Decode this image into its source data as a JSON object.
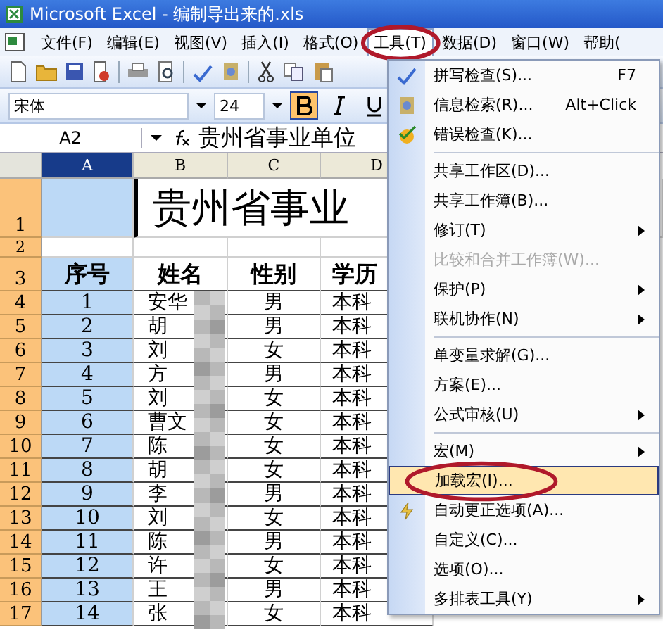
{
  "window": {
    "title": "Microsoft Excel - 编制导出来的.xls"
  },
  "menu_bar": [
    {
      "label": "文件(F)",
      "selected": false
    },
    {
      "label": "编辑(E)",
      "selected": false
    },
    {
      "label": "视图(V)",
      "selected": false
    },
    {
      "label": "插入(I)",
      "selected": false
    },
    {
      "label": "格式(O)",
      "selected": false
    },
    {
      "label": "工具(T)",
      "selected": true,
      "circled": true
    },
    {
      "label": "数据(D)",
      "selected": false
    },
    {
      "label": "窗口(W)",
      "selected": false
    },
    {
      "label": "帮助(",
      "selected": false
    }
  ],
  "format_toolbar": {
    "font": "宋体",
    "size": "24",
    "bold": true,
    "italic": false,
    "underline": false
  },
  "formula_bar": {
    "name_box": "A2",
    "content": "贵州省事业单位"
  },
  "sheet": {
    "columns": [
      {
        "label": "A",
        "selected": true
      },
      {
        "label": "B",
        "selected": false
      },
      {
        "label": "C",
        "selected": false
      },
      {
        "label": "D",
        "selected": false
      }
    ],
    "top_rows": [
      "1",
      "2",
      "3"
    ],
    "title": "贵州省事业",
    "headers": [
      "序号",
      "姓名",
      "性别",
      "学历"
    ],
    "rows": [
      {
        "row": "4",
        "cells": [
          "1",
          "安华",
          "男",
          "本科"
        ]
      },
      {
        "row": "5",
        "cells": [
          "2",
          "胡",
          "男",
          "本科"
        ]
      },
      {
        "row": "6",
        "cells": [
          "3",
          "刘",
          "女",
          "本科"
        ]
      },
      {
        "row": "7",
        "cells": [
          "4",
          "方",
          "男",
          "本科"
        ]
      },
      {
        "row": "8",
        "cells": [
          "5",
          "刘",
          "女",
          "本科"
        ]
      },
      {
        "row": "9",
        "cells": [
          "6",
          "曹文",
          "女",
          "本科"
        ]
      },
      {
        "row": "10",
        "cells": [
          "7",
          "陈",
          "女",
          "本科"
        ]
      },
      {
        "row": "11",
        "cells": [
          "8",
          "胡",
          "女",
          "本科"
        ]
      },
      {
        "row": "12",
        "cells": [
          "9",
          "李",
          "男",
          "本科"
        ]
      },
      {
        "row": "13",
        "cells": [
          "10",
          "刘",
          "女",
          "本科"
        ]
      },
      {
        "row": "14",
        "cells": [
          "11",
          "陈",
          "男",
          "本科"
        ]
      },
      {
        "row": "15",
        "cells": [
          "12",
          "许",
          "女",
          "本科"
        ]
      },
      {
        "row": "16",
        "cells": [
          "13",
          "王",
          "男",
          "本科"
        ]
      },
      {
        "row": "17",
        "cells": [
          "14",
          "张",
          "女",
          "本科"
        ]
      }
    ]
  },
  "tools_menu": {
    "items": [
      {
        "kind": "item",
        "label": "拼写检查(S)...",
        "shortcut": "F7"
      },
      {
        "kind": "item",
        "label": "信息检索(R)...",
        "shortcut": "Alt+Click"
      },
      {
        "kind": "item",
        "label": "错误检查(K)..."
      },
      {
        "kind": "separator"
      },
      {
        "kind": "item",
        "label": "共享工作区(D)..."
      },
      {
        "kind": "item",
        "label": "共享工作簿(B)..."
      },
      {
        "kind": "submenu",
        "label": "修订(T)"
      },
      {
        "kind": "item",
        "label": "比较和合并工作簿(W)...",
        "disabled": true
      },
      {
        "kind": "submenu",
        "label": "保护(P)"
      },
      {
        "kind": "submenu",
        "label": "联机协作(N)"
      },
      {
        "kind": "separator"
      },
      {
        "kind": "item",
        "label": "单变量求解(G)..."
      },
      {
        "kind": "item",
        "label": "方案(E)..."
      },
      {
        "kind": "submenu",
        "label": "公式审核(U)"
      },
      {
        "kind": "separator"
      },
      {
        "kind": "submenu",
        "label": "宏(M)"
      },
      {
        "kind": "item",
        "label": "加载宏(I)...",
        "selected": true,
        "circled": true
      },
      {
        "kind": "item",
        "label": "自动更正选项(A)..."
      },
      {
        "kind": "item",
        "label": "自定义(C)..."
      },
      {
        "kind": "item",
        "label": "选项(O)..."
      },
      {
        "kind": "submenu",
        "label": "多排表工具(Y)"
      }
    ]
  }
}
